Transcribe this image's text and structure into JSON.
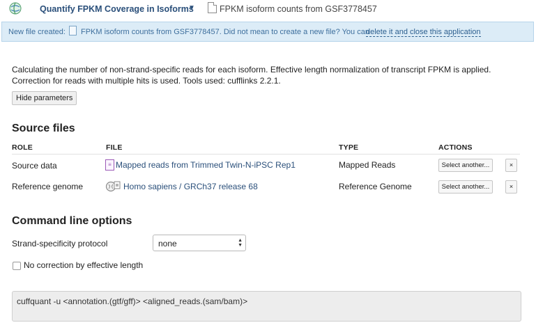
{
  "header": {
    "app_title": "Quantify FPKM Coverage in Isoforms",
    "file_title": "FPKM isoform counts from GSF3778457"
  },
  "notice": {
    "prefix": "New file created:",
    "file_name": "FPKM isoform counts from GSF3778457.",
    "middle": "Did not mean to create a new file? You can",
    "link": "delete it and close this application"
  },
  "description": "Calculating the number of non-strand-specific reads for each isoform. Effective length normalization of transcript FPKM is applied. Correction for reads with multiple hits is used. Tools used: cufflinks 2.2.1.",
  "hide_parameters_label": "Hide parameters",
  "source_files": {
    "heading": "Source files",
    "columns": [
      "ROLE",
      "FILE",
      "TYPE",
      "ACTIONS"
    ],
    "rows": [
      {
        "role": "Source data",
        "file": "Mapped reads from Trimmed Twin-N-iPSC Rep1",
        "type": "Mapped Reads",
        "action": "Select another...",
        "remove": "×"
      },
      {
        "role": "Reference genome",
        "file": "Homo sapiens / GRCh37 release 68",
        "type": "Reference Genome",
        "action": "Select another...",
        "remove": "×"
      }
    ]
  },
  "command_options": {
    "heading": "Command line options",
    "strand_label": "Strand-specificity protocol",
    "strand_value": "none",
    "checkbox_label": "No correction by effective length",
    "checkbox_checked": false
  },
  "command_line": "cuffquant -u  <annotation.(gtf/gff)> <aligned_reads.(sam/bam)>",
  "colors": {
    "link": "#2a4f7a",
    "notice_bg": "#dcecf7",
    "reads_icon": "#9b59b6"
  }
}
